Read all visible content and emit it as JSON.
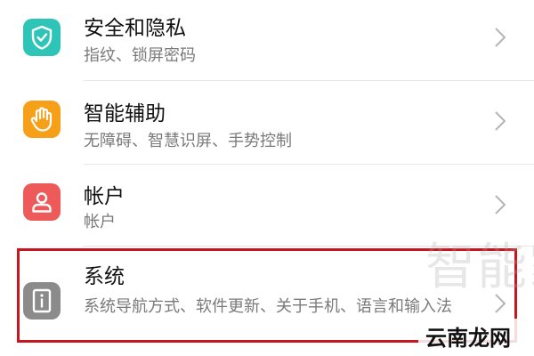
{
  "items": [
    {
      "title": "安全和隐私",
      "subtitle": "指纹、锁屏密码",
      "icon": "shield-check-icon",
      "icon_color": "#2ec4b8"
    },
    {
      "title": "智能辅助",
      "subtitle": "无障碍、智慧识屏、手势控制",
      "icon": "hand-icon",
      "icon_color": "#f6a01a"
    },
    {
      "title": "帐户",
      "subtitle": "帐户",
      "icon": "person-icon",
      "icon_color": "#ee5a5a"
    },
    {
      "title": "系统",
      "subtitle": "系统导航方式、软件更新、关于手机、语言和输入法",
      "icon": "info-device-icon",
      "icon_color": "#8b8b8b"
    }
  ],
  "highlight_color": "#c7161e",
  "watermark": {
    "text": "云南龙网",
    "faint_text": "智能家"
  }
}
